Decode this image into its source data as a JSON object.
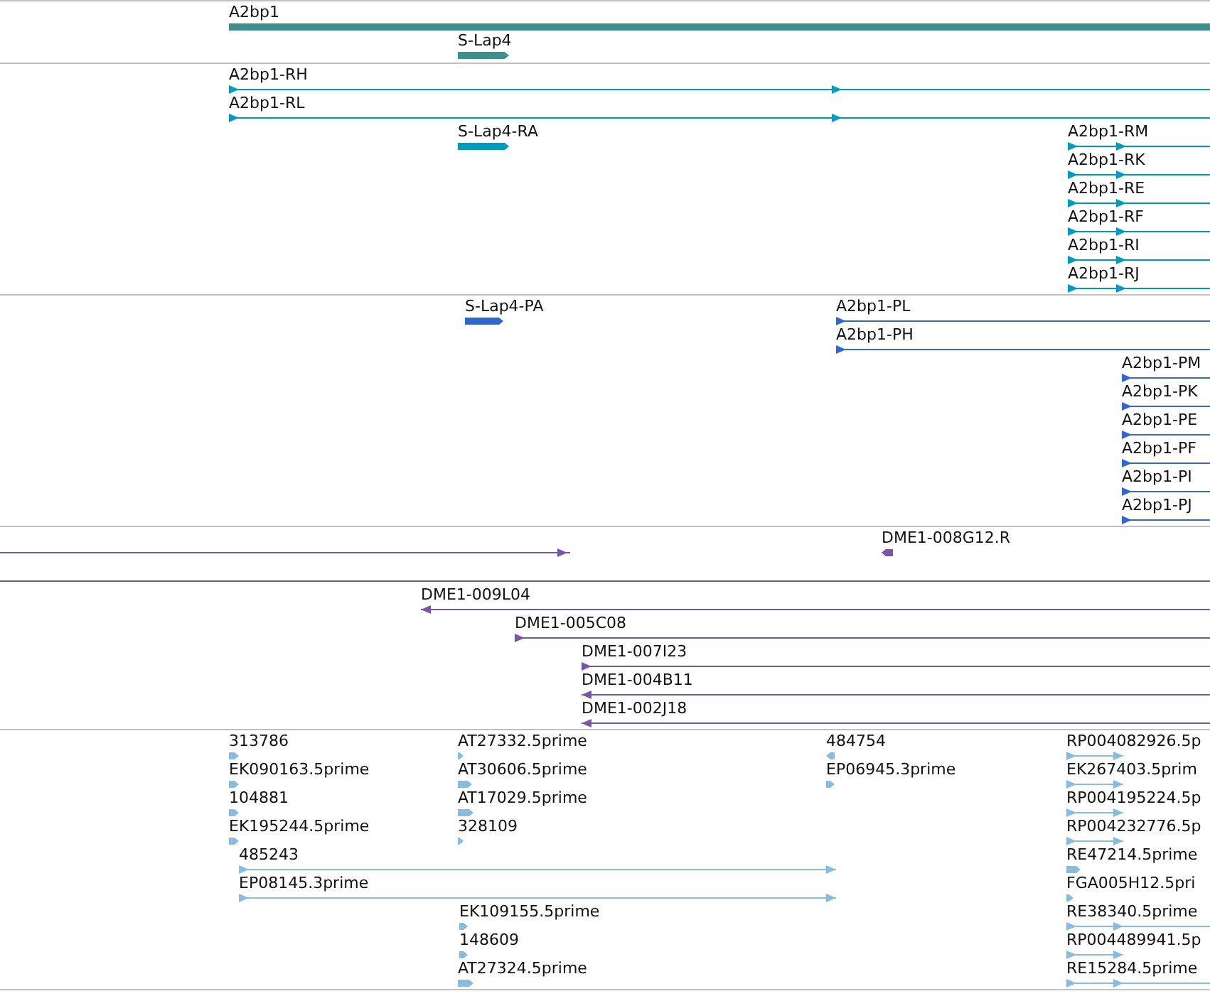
{
  "tracks": [
    {
      "color": "#3f8f91",
      "features": [
        {
          "label": "A2bp1",
          "kind": "bar"
        },
        {
          "label": "S-Lap4",
          "kind": "bar",
          "reverse": false
        }
      ]
    },
    {
      "color": "#0099c0",
      "features": [
        {
          "label": "A2bp1-RH",
          "kind": "line",
          "reverse": false
        },
        {
          "label": "A2bp1-RL",
          "kind": "line",
          "reverse": false
        },
        {
          "label": "S-Lap4-RA",
          "kind": "bar",
          "reverse": false
        },
        {
          "label": "A2bp1-RM",
          "kind": "line",
          "reverse": false
        },
        {
          "label": "A2bp1-RK",
          "kind": "line",
          "reverse": false
        },
        {
          "label": "A2bp1-RE",
          "kind": "line",
          "reverse": false
        },
        {
          "label": "A2bp1-RF",
          "kind": "line",
          "reverse": false
        },
        {
          "label": "A2bp1-RI",
          "kind": "line",
          "reverse": false
        },
        {
          "label": "A2bp1-RJ",
          "kind": "line",
          "reverse": false
        }
      ]
    },
    {
      "color": "#3366cc",
      "features": [
        {
          "label": "S-Lap4-PA",
          "kind": "bar",
          "reverse": false
        },
        {
          "label": "A2bp1-PL",
          "kind": "line",
          "reverse": false
        },
        {
          "label": "A2bp1-PH",
          "kind": "line",
          "reverse": false
        },
        {
          "label": "A2bp1-PM",
          "kind": "line",
          "reverse": false
        },
        {
          "label": "A2bp1-PK",
          "kind": "line",
          "reverse": false
        },
        {
          "label": "A2bp1-PE",
          "kind": "line",
          "reverse": false
        },
        {
          "label": "A2bp1-PF",
          "kind": "line",
          "reverse": false
        },
        {
          "label": "A2bp1-PI",
          "kind": "line",
          "reverse": false
        },
        {
          "label": "A2bp1-PJ",
          "kind": "line",
          "reverse": false
        }
      ]
    },
    {
      "color": "#7755aa",
      "features": [
        {
          "kind": "line",
          "reverse": false
        },
        {
          "label": "DME1-008G12.R",
          "kind": "bar",
          "reverse": true
        },
        {
          "kind": "line"
        },
        {
          "label": "DME1-009L04",
          "kind": "line",
          "reverse": true
        },
        {
          "label": "DME1-005C08",
          "kind": "line",
          "reverse": false
        },
        {
          "label": "DME1-007I23",
          "kind": "line",
          "reverse": false
        },
        {
          "label": "DME1-004B11",
          "kind": "line",
          "reverse": true
        },
        {
          "label": "DME1-002J18",
          "kind": "line",
          "reverse": true
        }
      ]
    },
    {
      "color": "#88bbdd",
      "features": [
        {
          "label": "313786",
          "kind": "bar",
          "reverse": false
        },
        {
          "label": "EK090163.5prime",
          "kind": "bar",
          "reverse": false
        },
        {
          "label": "104881",
          "kind": "bar",
          "reverse": false
        },
        {
          "label": "EK195244.5prime",
          "kind": "bar",
          "reverse": false
        },
        {
          "label": "485243",
          "kind": "line",
          "reverse": false
        },
        {
          "label": "EP08145.3prime",
          "kind": "line",
          "reverse": false
        },
        {
          "label": "AT27332.5prime",
          "kind": "bar",
          "reverse": false
        },
        {
          "label": "AT30606.5prime",
          "kind": "bar",
          "reverse": false
        },
        {
          "label": "AT17029.5prime",
          "kind": "bar",
          "reverse": false
        },
        {
          "label": "328109",
          "kind": "bar",
          "reverse": false
        },
        {
          "label": "EK109155.5prime",
          "kind": "bar",
          "reverse": false
        },
        {
          "label": "148609",
          "kind": "bar",
          "reverse": false
        },
        {
          "label": "AT27324.5prime",
          "kind": "bar",
          "reverse": false
        },
        {
          "label": "484754",
          "kind": "bar",
          "reverse": true
        },
        {
          "label": "EP06945.3prime",
          "kind": "bar",
          "reverse": false
        },
        {
          "label": "RP004082926.5p",
          "kind": "line",
          "reverse": false
        },
        {
          "label": "EK267403.5prim",
          "kind": "line",
          "reverse": false
        },
        {
          "label": "RP004195224.5p",
          "kind": "line",
          "reverse": false
        },
        {
          "label": "RP004232776.5p",
          "kind": "line",
          "reverse": false
        },
        {
          "label": "RE47214.5prime",
          "kind": "bar",
          "reverse": false
        },
        {
          "label": "FGA005H12.5pri",
          "kind": "bar",
          "reverse": false
        },
        {
          "label": "RE38340.5prime",
          "kind": "line",
          "reverse": false
        },
        {
          "label": "RP004489941.5p",
          "kind": "line",
          "reverse": false
        },
        {
          "label": "RE15284.5prime",
          "kind": "line",
          "reverse": false
        }
      ]
    }
  ]
}
